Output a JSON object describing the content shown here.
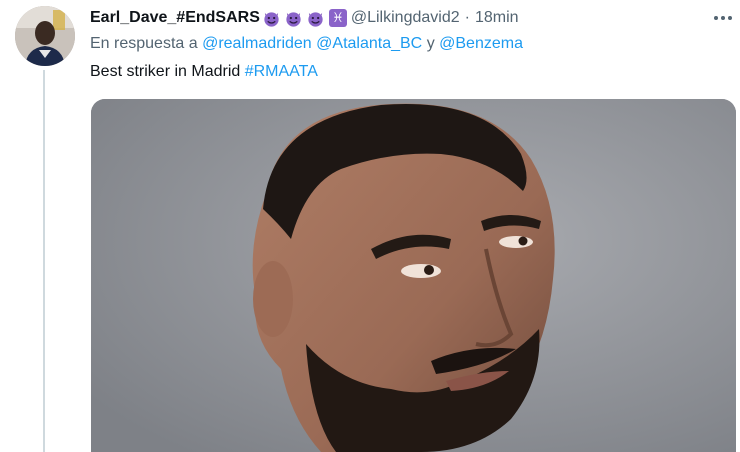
{
  "tweet": {
    "display_name": "Earl_Dave_#EndSARS",
    "name_emojis": [
      "smiling-imp-emoji",
      "smiling-imp-emoji",
      "smiling-imp-emoji",
      "pisces-emoji"
    ],
    "pisces_glyph": "♓",
    "handle": "@Lilkingdavid2",
    "separator": "·",
    "time": "18min",
    "reply_prefix": "En respuesta a",
    "mentions": [
      "@realmadriden",
      "@Atalanta_BC",
      "@Benzema"
    ],
    "reply_conjunction": "y",
    "text": "Best striker in Madrid",
    "hashtag": "#RMAATA"
  },
  "colors": {
    "link": "#1d9bf0",
    "secondary_text": "#536471",
    "primary_text": "#0f1419",
    "thread_line": "#cfd9de",
    "emoji_purple": "#8a63c9"
  },
  "icons": {
    "more": "more-horizontal-icon"
  }
}
